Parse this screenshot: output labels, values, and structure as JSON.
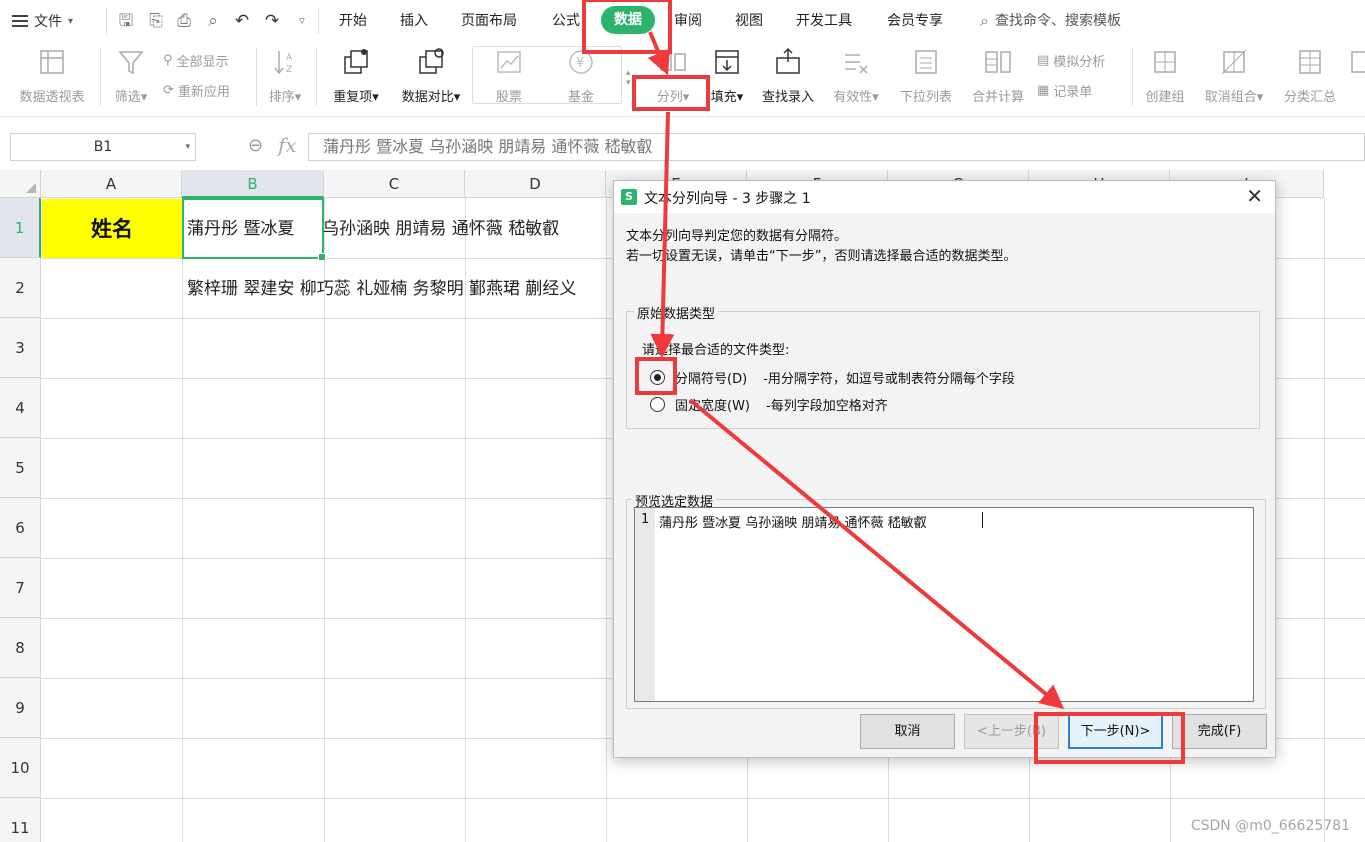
{
  "menubar": {
    "file_label": "文件",
    "tabs": [
      "开始",
      "插入",
      "页面布局",
      "公式",
      "数据",
      "审阅",
      "视图",
      "开发工具",
      "会员专享"
    ],
    "search_placeholder": "查找命令、搜索模板"
  },
  "ribbon": {
    "pivot": "数据透视表",
    "filter": "筛选",
    "show_all": "全部显示",
    "reapply": "重新应用",
    "sort": "排序",
    "duplicates": "重复项",
    "compare": "数据对比",
    "stock": "股票",
    "fund": "基金",
    "split": "分列",
    "fill": "填充",
    "lookup": "查找录入",
    "validity": "有效性",
    "dropdown": "下拉列表",
    "consolidate": "合并计算",
    "simulate": "模拟分析",
    "record": "记录单",
    "group": "创建组",
    "ungroup": "取消组合",
    "subtotal": "分类汇总"
  },
  "formula_bar": {
    "cell_ref": "B1",
    "fx": "fx",
    "content": "蒲丹彤  暨冰夏   乌孙涵映  朋靖易  通怀薇  嵇敏叡"
  },
  "grid": {
    "columns": [
      "A",
      "B",
      "C",
      "D",
      "E",
      "F",
      "G",
      "H",
      "I"
    ],
    "rows": [
      "1",
      "2",
      "3",
      "4",
      "5",
      "6",
      "7",
      "8",
      "9",
      "10",
      "11"
    ],
    "a1": "姓名",
    "b1": "蒲丹彤  暨冰夏",
    "c1": "乌孙涵映  朋靖易  通怀薇  嵇敏叡",
    "b2": "繁梓珊  翠建安  柳巧蕊  礼娅楠  务黎明  鄞燕珺  蒯经义"
  },
  "dialog": {
    "title": "文本分列向导 - 3 步骤之 1",
    "line1": "文本分列向导判定您的数据有分隔符。",
    "line2": "若一切设置无误，请单击“下一步”，否则请选择最合适的数据类型。",
    "group_title": "原始数据类型",
    "choose_label": "请选择最合适的文件类型:",
    "opt_delimited": "分隔符号(D)",
    "opt_delimited_desc": "-用分隔字符，如逗号或制表符分隔每个字段",
    "opt_fixed": "固定宽度(W)",
    "opt_fixed_desc": "-每列字段加空格对齐",
    "preview_title": "预览选定数据",
    "preview_line_num": "1",
    "preview_text": "蒲丹彤 暨冰夏  乌孙涵映 朋靖易 通怀薇 嵇敏叡",
    "btn_cancel": "取消",
    "btn_back": "<上一步(B)",
    "btn_next": "下一步(N)>",
    "btn_finish": "完成(F)"
  },
  "watermark": "CSDN @m0_66625781",
  "colors": {
    "accent_green": "#2db36d",
    "annotation_red": "#ee3a3d",
    "highlight_yellow": "#ffff00"
  },
  "icons": [
    "hamburger-icon",
    "save-icon",
    "undo-icon",
    "redo-icon",
    "search-icon",
    "close-icon",
    "radio-selected-icon"
  ]
}
